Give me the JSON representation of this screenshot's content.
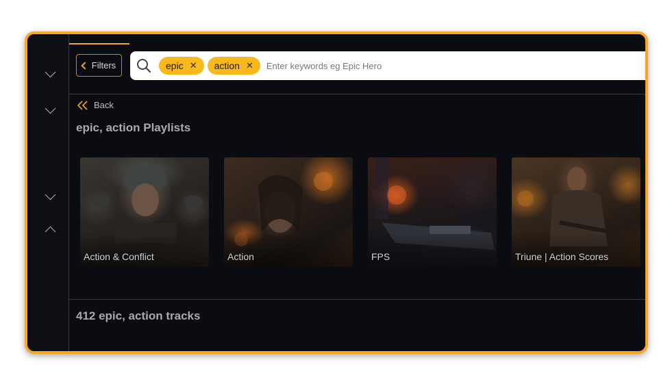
{
  "filters": {
    "label": "Filters"
  },
  "search": {
    "tags": [
      {
        "label": "epic",
        "remove": "✕"
      },
      {
        "label": "action",
        "remove": "✕"
      }
    ],
    "placeholder": "Enter keywords eg Epic Hero"
  },
  "nav": {
    "back_label": "Back"
  },
  "playlists": {
    "title": "epic, action Playlists",
    "items": [
      {
        "label": "Action & Conflict"
      },
      {
        "label": "Action"
      },
      {
        "label": "FPS"
      },
      {
        "label": "Triune | Action Scores"
      }
    ]
  },
  "tracks": {
    "title": "412 epic, action tracks"
  },
  "colors": {
    "accent": "#f5a623",
    "tag": "#f9b91c",
    "background": "#0b0b12"
  }
}
